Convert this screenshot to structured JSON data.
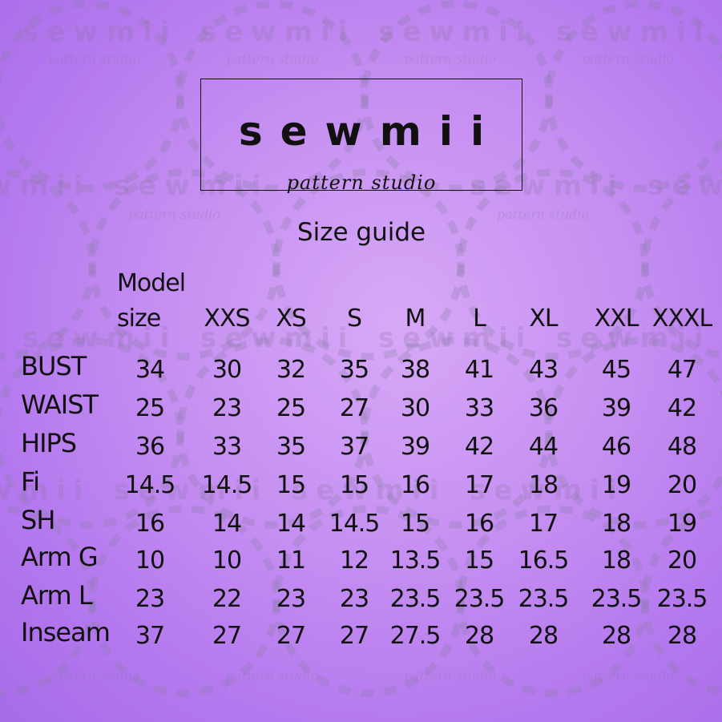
{
  "watermark": {
    "word": "sewmii",
    "tagline": "pattern studio"
  },
  "logo": {
    "word": "sewmii",
    "tagline": "pattern studio"
  },
  "title": "Size guide",
  "table": {
    "header_first": [
      "Model",
      "size"
    ],
    "sizes": [
      "XXS",
      "XS",
      "S",
      "M",
      "L",
      "XL",
      "XXL",
      "XXXL"
    ],
    "rows": [
      {
        "label": "BUST",
        "values": [
          "34",
          "30",
          "32",
          "35",
          "38",
          "41",
          "43",
          "45",
          "47"
        ]
      },
      {
        "label": "WAIST",
        "values": [
          "25",
          "23",
          "25",
          "27",
          "30",
          "33",
          "36",
          "39",
          "42"
        ]
      },
      {
        "label": "HIPS",
        "values": [
          "36",
          "33",
          "35",
          "37",
          "39",
          "42",
          "44",
          "46",
          "48"
        ]
      },
      {
        "label": "Fi",
        "values": [
          "14.5",
          "14.5",
          "15",
          "15",
          "16",
          "17",
          "18",
          "19",
          "20"
        ]
      },
      {
        "label": "SH",
        "values": [
          "16",
          "14",
          "14",
          "14.5",
          "15",
          "16",
          "17",
          "18",
          "19"
        ]
      },
      {
        "label": "Arm G",
        "values": [
          "10",
          "10",
          "11",
          "12",
          "13.5",
          "15",
          "16.5",
          "18",
          "20"
        ]
      },
      {
        "label": "Arm L",
        "values": [
          "23",
          "22",
          "23",
          "23",
          "23.5",
          "23.5",
          "23.5",
          "23.5",
          "23.5"
        ]
      },
      {
        "label": "Inseam",
        "values": [
          "37",
          "27",
          "27",
          "27",
          "27.5",
          "28",
          "28",
          "28",
          "28"
        ]
      }
    ]
  }
}
